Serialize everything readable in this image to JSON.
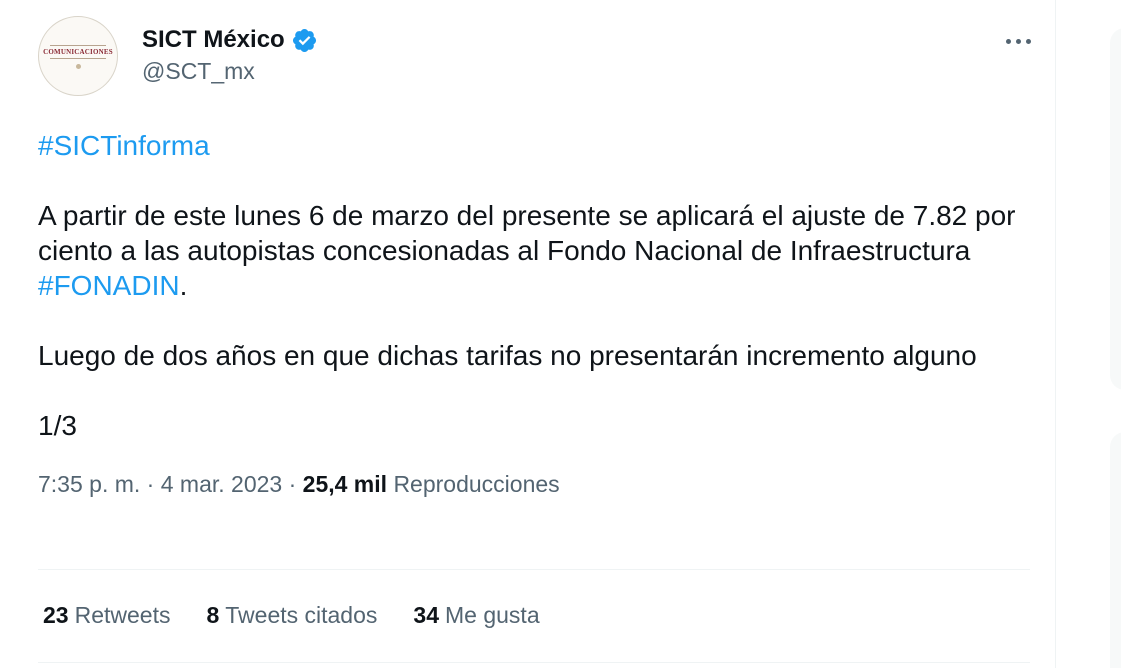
{
  "author": {
    "display_name": "SICT México",
    "handle": "@SCT_mx",
    "avatar_text": "COMUNICACIONES",
    "verified": true,
    "verified_color": "#1d9bf0"
  },
  "tweet": {
    "hashtag_1": "#SICTinforma",
    "paragraph_1_prefix": "A partir de este lunes 6 de marzo del presente se aplicará el ajuste de 7.82 por ciento a las autopistas concesionadas al Fondo Nacional de Infraestructura ",
    "hashtag_2": "#FONADIN",
    "paragraph_1_suffix": ".",
    "paragraph_2": "Luego de dos años en que dichas tarifas no presentarán incremento alguno",
    "paragraph_3": "1/3",
    "time": "7:35 p. m.",
    "sep_1": " · ",
    "date": "4 mar. 2023",
    "sep_2": " · ",
    "views_count": "25,4 mil",
    "views_label": "Reproducciones"
  },
  "stats": {
    "retweets_count": "23",
    "retweets_label": "Retweets",
    "quotes_count": "8",
    "quotes_label": "Tweets citados",
    "likes_count": "34",
    "likes_label": "Me gusta"
  },
  "icons": {
    "verified": "verified-badge-icon",
    "more": "more-options-icon"
  },
  "colors": {
    "link": "#1d9bf0",
    "secondary_text": "#536471",
    "primary_text": "#0f1419"
  }
}
